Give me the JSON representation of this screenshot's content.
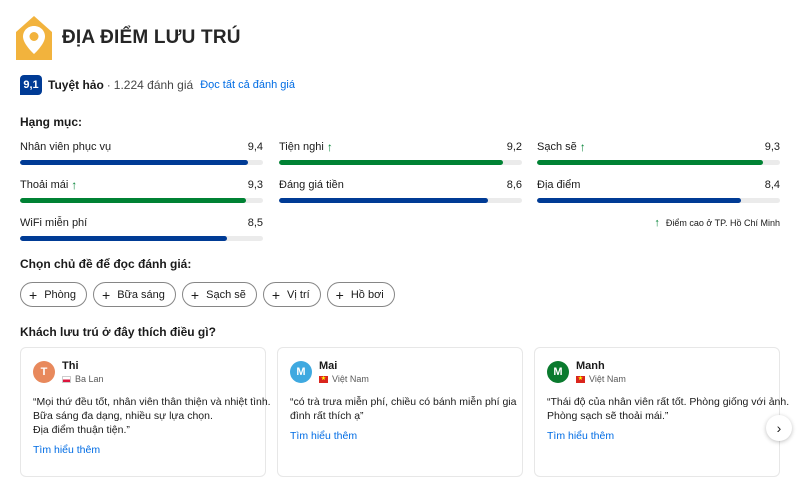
{
  "header": {
    "title": "ĐỊA ĐIỂM LƯU TRÚ",
    "logo_icon": "map-pin-house-icon",
    "logo_color": "#f2b33d"
  },
  "summary": {
    "score": "9,1",
    "word": "Tuyệt hảo",
    "separator": "·",
    "count": "1.224 đánh giá",
    "read_all": "Đọc tất cả đánh giá",
    "badge_color": "#003b95"
  },
  "categories_label": "Hạng mục:",
  "categories": [
    {
      "name": "Nhân viên phục vụ",
      "score": "9,4",
      "value": 9.4,
      "high": false,
      "color": "#003b95"
    },
    {
      "name": "Tiện nghi",
      "score": "9,2",
      "value": 9.2,
      "high": true,
      "color": "#008234"
    },
    {
      "name": "Sạch sẽ",
      "score": "9,3",
      "value": 9.3,
      "high": true,
      "color": "#008234"
    },
    {
      "name": "Thoải mái",
      "score": "9,3",
      "value": 9.3,
      "high": true,
      "color": "#008234"
    },
    {
      "name": "Đáng giá tiền",
      "score": "8,6",
      "value": 8.6,
      "high": false,
      "color": "#003b95"
    },
    {
      "name": "Địa điểm",
      "score": "8,4",
      "value": 8.4,
      "high": false,
      "color": "#003b95"
    },
    {
      "name": "WiFi miễn phí",
      "score": "8,5",
      "value": 8.5,
      "high": false,
      "color": "#003b95"
    }
  ],
  "high_note": "Điểm cao ở TP. Hồ Chí Minh",
  "topics_label": "Chọn chủ đề để đọc đánh giá:",
  "topics": [
    "Phòng",
    "Bữa sáng",
    "Sạch sẽ",
    "Vị trí",
    "Hồ bơi"
  ],
  "guests_label": "Khách lưu trú ở đây thích điều gì?",
  "reviews": [
    {
      "initial": "T",
      "avatar_color": "#e8895c",
      "name": "Thi",
      "country": "Ba Lan",
      "flag": "poland",
      "lines": [
        "“Mọi thứ đều tốt, nhân viên thân thiện và nhiệt tình.",
        "Bữa sáng đa dạng, nhiều sự lựa chọn.",
        "Địa điểm thuận tiện.”"
      ],
      "more": "Tìm hiểu thêm"
    },
    {
      "initial": "M",
      "avatar_color": "#3fa9e0",
      "name": "Mai",
      "country": "Việt Nam",
      "flag": "vietnam",
      "lines": [
        "“có trà trưa miễn phí, chiều có bánh miễn phí gia",
        "đình rất thích ạ”"
      ],
      "more": "Tìm hiểu thêm"
    },
    {
      "initial": "M",
      "avatar_color": "#0a7a2e",
      "name": "Manh",
      "country": "Việt Nam",
      "flag": "vietnam",
      "lines": [
        "“Thái độ của nhân viên rất tốt. Phòng giống với ảnh.",
        "Phòng sạch sẽ thoải mái.”"
      ],
      "more": "Tìm hiểu thêm"
    }
  ],
  "next_icon": "chevron-right-icon"
}
